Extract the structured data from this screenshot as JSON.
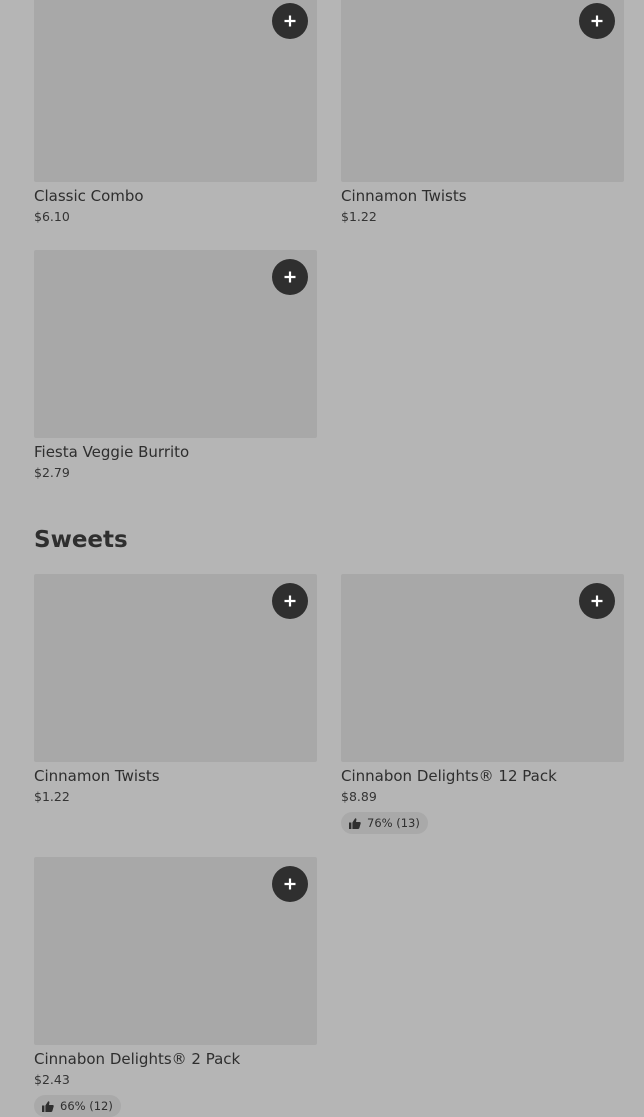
{
  "top_items": [
    {
      "name": "Classic Combo",
      "price": "$6.10"
    },
    {
      "name": "Cinnamon Twists",
      "price": "$1.22"
    },
    {
      "name": "Fiesta Veggie Burrito",
      "price": "$2.79"
    }
  ],
  "sweets": {
    "title": "Sweets",
    "items": [
      {
        "name": "Cinnamon Twists",
        "price": "$1.22"
      },
      {
        "name": "Cinnabon Delights® 12 Pack",
        "price": "$8.89",
        "rating": "76% (13)"
      },
      {
        "name": "Cinnabon Delights® 2 Pack",
        "price": "$2.43",
        "rating": "66% (12)"
      }
    ]
  },
  "icons": {
    "add": "plus-icon",
    "rating": "thumbs-up-icon"
  },
  "colors": {
    "background": "#b5b5b5",
    "image_placeholder": "#a8a8a8",
    "add_button": "#2f2f2f"
  }
}
